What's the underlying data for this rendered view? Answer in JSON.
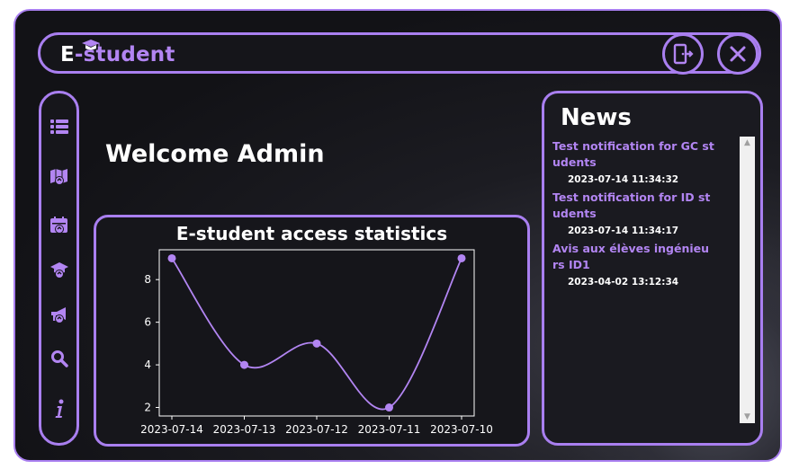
{
  "app": {
    "brand_first": "E",
    "brand_rest": "-student"
  },
  "header": {
    "logout_icon": "logout-door-icon",
    "close_icon": "close-x-icon"
  },
  "sidebar": {
    "items": [
      {
        "icon": "list-icon"
      },
      {
        "icon": "map-upload-icon"
      },
      {
        "icon": "calendar-upload-icon"
      },
      {
        "icon": "graduation-cap-upload-icon"
      },
      {
        "icon": "megaphone-upload-icon"
      },
      {
        "icon": "search-icon"
      },
      {
        "icon": "info-icon"
      }
    ]
  },
  "main": {
    "welcome": "Welcome Admin"
  },
  "chart_data": {
    "type": "line",
    "title": "E-student access statistics",
    "categories": [
      "2023-07-14",
      "2023-07-13",
      "2023-07-12",
      "2023-07-11",
      "2023-07-10"
    ],
    "values": [
      9,
      4,
      5,
      2,
      9
    ],
    "yticks": [
      2,
      4,
      6,
      8
    ],
    "ylim": [
      1.6,
      9.4
    ],
    "xlabel": "",
    "ylabel": "",
    "grid": false,
    "line_color": "#b285f2",
    "smooth": true
  },
  "news": {
    "title": "News",
    "items": [
      {
        "title": "Test notification for GC students",
        "date": "2023-07-14 11:34:32"
      },
      {
        "title": "Test notification for ID students",
        "date": "2023-07-14 11:34:17"
      },
      {
        "title": "Avis aux élèves ingénieurs ID1",
        "date": "2023-04-02 13:12:34"
      }
    ]
  },
  "colors": {
    "accent": "#a97ff0",
    "accent_text": "#b285f2",
    "background": "#15151a"
  }
}
